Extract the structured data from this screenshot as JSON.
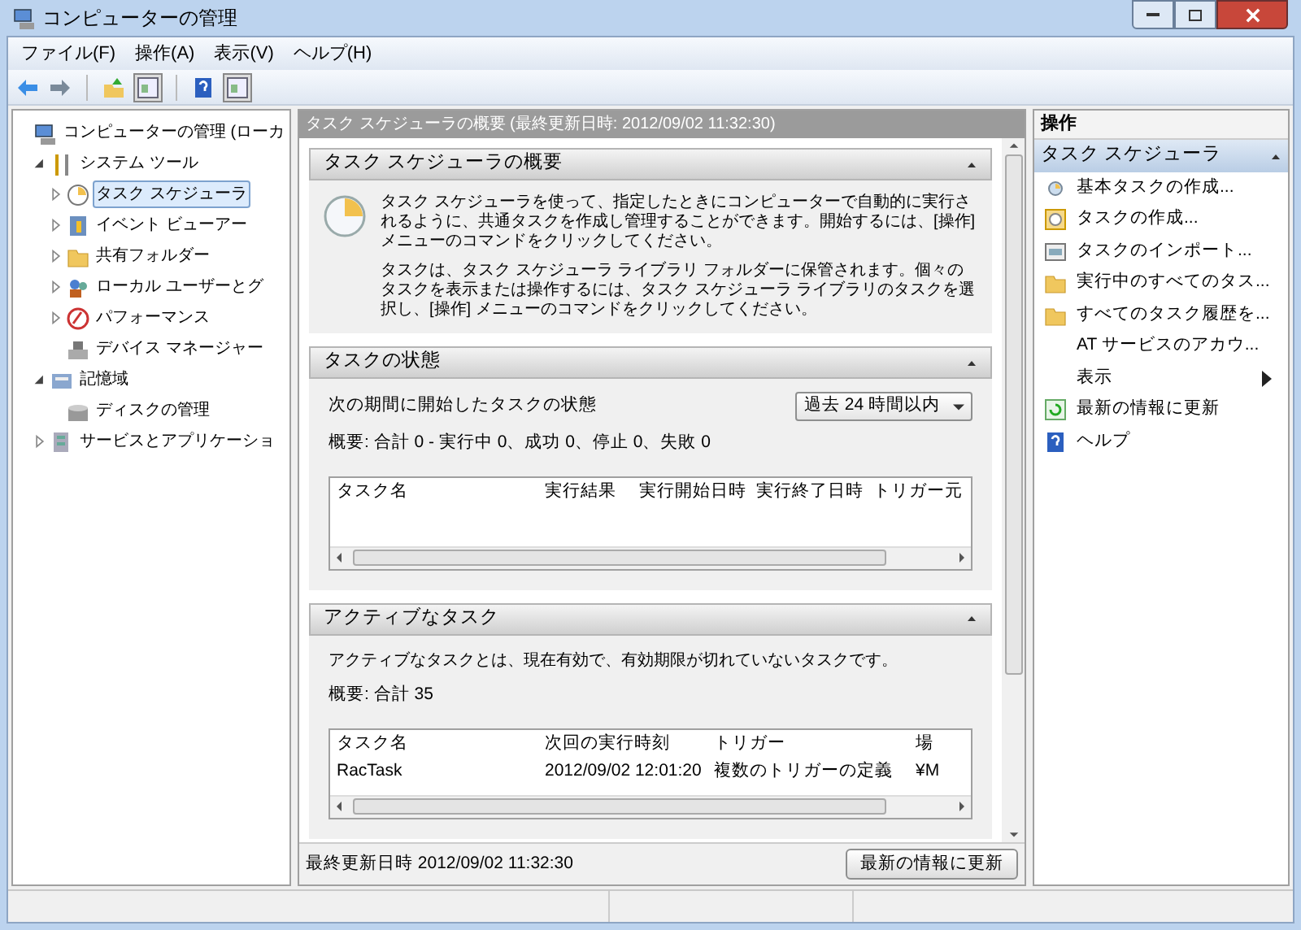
{
  "window": {
    "title": "コンピューターの管理"
  },
  "menu": [
    "ファイル(F)",
    "操作(A)",
    "表示(V)",
    "ヘルプ(H)"
  ],
  "tree": [
    {
      "label": "コンピューターの管理 (ローカ",
      "selected": false,
      "children": [
        {
          "label": "システム ツール",
          "expanded": true,
          "selected": false,
          "children": [
            {
              "label": "タスク スケジューラ",
              "expanded": false,
              "selected": true
            },
            {
              "label": "イベント ビューアー",
              "expanded": false,
              "selected": false
            },
            {
              "label": "共有フォルダー",
              "expanded": false,
              "selected": false
            },
            {
              "label": "ローカル ユーザーとグ",
              "expanded": false,
              "selected": false
            },
            {
              "label": "パフォーマンス",
              "expanded": false,
              "selected": false
            },
            {
              "label": "デバイス マネージャー",
              "selected": false
            }
          ]
        },
        {
          "label": "記憶域",
          "expanded": true,
          "selected": false,
          "children": [
            {
              "label": "ディスクの管理",
              "selected": false
            }
          ]
        },
        {
          "label": "サービスとアプリケーショ",
          "expanded": false,
          "selected": false
        }
      ]
    }
  ],
  "center": {
    "header": "タスク スケジューラの概要 (最終更新日時: 2012/09/02 11:32:30)",
    "sections": [
      {
        "kind": "overview",
        "title": "タスク スケジューラの概要",
        "expanded": true,
        "paragraphs": [
          "タスク スケジューラを使って、指定したときにコンピューターで自動的に実行されるように、共通タスクを作成し管理することができます。開始するには、[操作] メニューのコマンドをクリックしてください。",
          "タスクは、タスク スケジューラ ライブラリ フォルダーに保管されます。個々のタスクを表示または操作するには、タスク スケジューラ ライブラリのタスクを選択し、[操作] メニューのコマンドをクリックしてください。"
        ]
      },
      {
        "kind": "status",
        "title": "タスクの状態",
        "expanded": true,
        "filter_label": "次の期間に開始したタスクの状態",
        "filter_value": "過去 24 時間以内",
        "summary": "概要: 合計 0 - 実行中 0、成功 0、停止 0、失敗 0",
        "table": {
          "columns": [
            "タスク名",
            "実行結果",
            "実行開始日時",
            "実行終了日時",
            "トリガー元"
          ]
        }
      },
      {
        "kind": "active",
        "title": "アクティブなタスク",
        "expanded": true,
        "description": "アクティブなタスクとは、現在有効で、有効期限が切れていないタスクです。",
        "summary": "概要: 合計 35",
        "table": {
          "columns": [
            "タスク名",
            "次回の実行時刻",
            "トリガー",
            "場"
          ],
          "rows": [
            [
              "RacTask",
              "2012/09/02 12:01:20",
              "複数のトリガーの定義",
              "¥M"
            ]
          ]
        }
      }
    ],
    "footer": {
      "text": "最終更新日時 2012/09/02 11:32:30",
      "button": "最新の情報に更新"
    }
  },
  "actions": {
    "title": "操作",
    "group": {
      "title": "タスク スケジューラ",
      "expanded": true
    },
    "items": [
      {
        "label": "基本タスクの作成...",
        "kind": "command"
      },
      {
        "label": "タスクの作成...",
        "kind": "command"
      },
      {
        "label": "タスクのインポート...",
        "kind": "command"
      },
      {
        "label": "実行中のすべてのタス...",
        "kind": "command"
      },
      {
        "label": "すべてのタスク履歴を...",
        "kind": "command"
      },
      {
        "label": "AT サービスのアカウ...",
        "kind": "command"
      },
      {
        "label": "表示",
        "kind": "submenu"
      },
      {
        "label": "最新の情報に更新",
        "kind": "command"
      },
      {
        "label": "ヘルプ",
        "kind": "command"
      }
    ]
  }
}
